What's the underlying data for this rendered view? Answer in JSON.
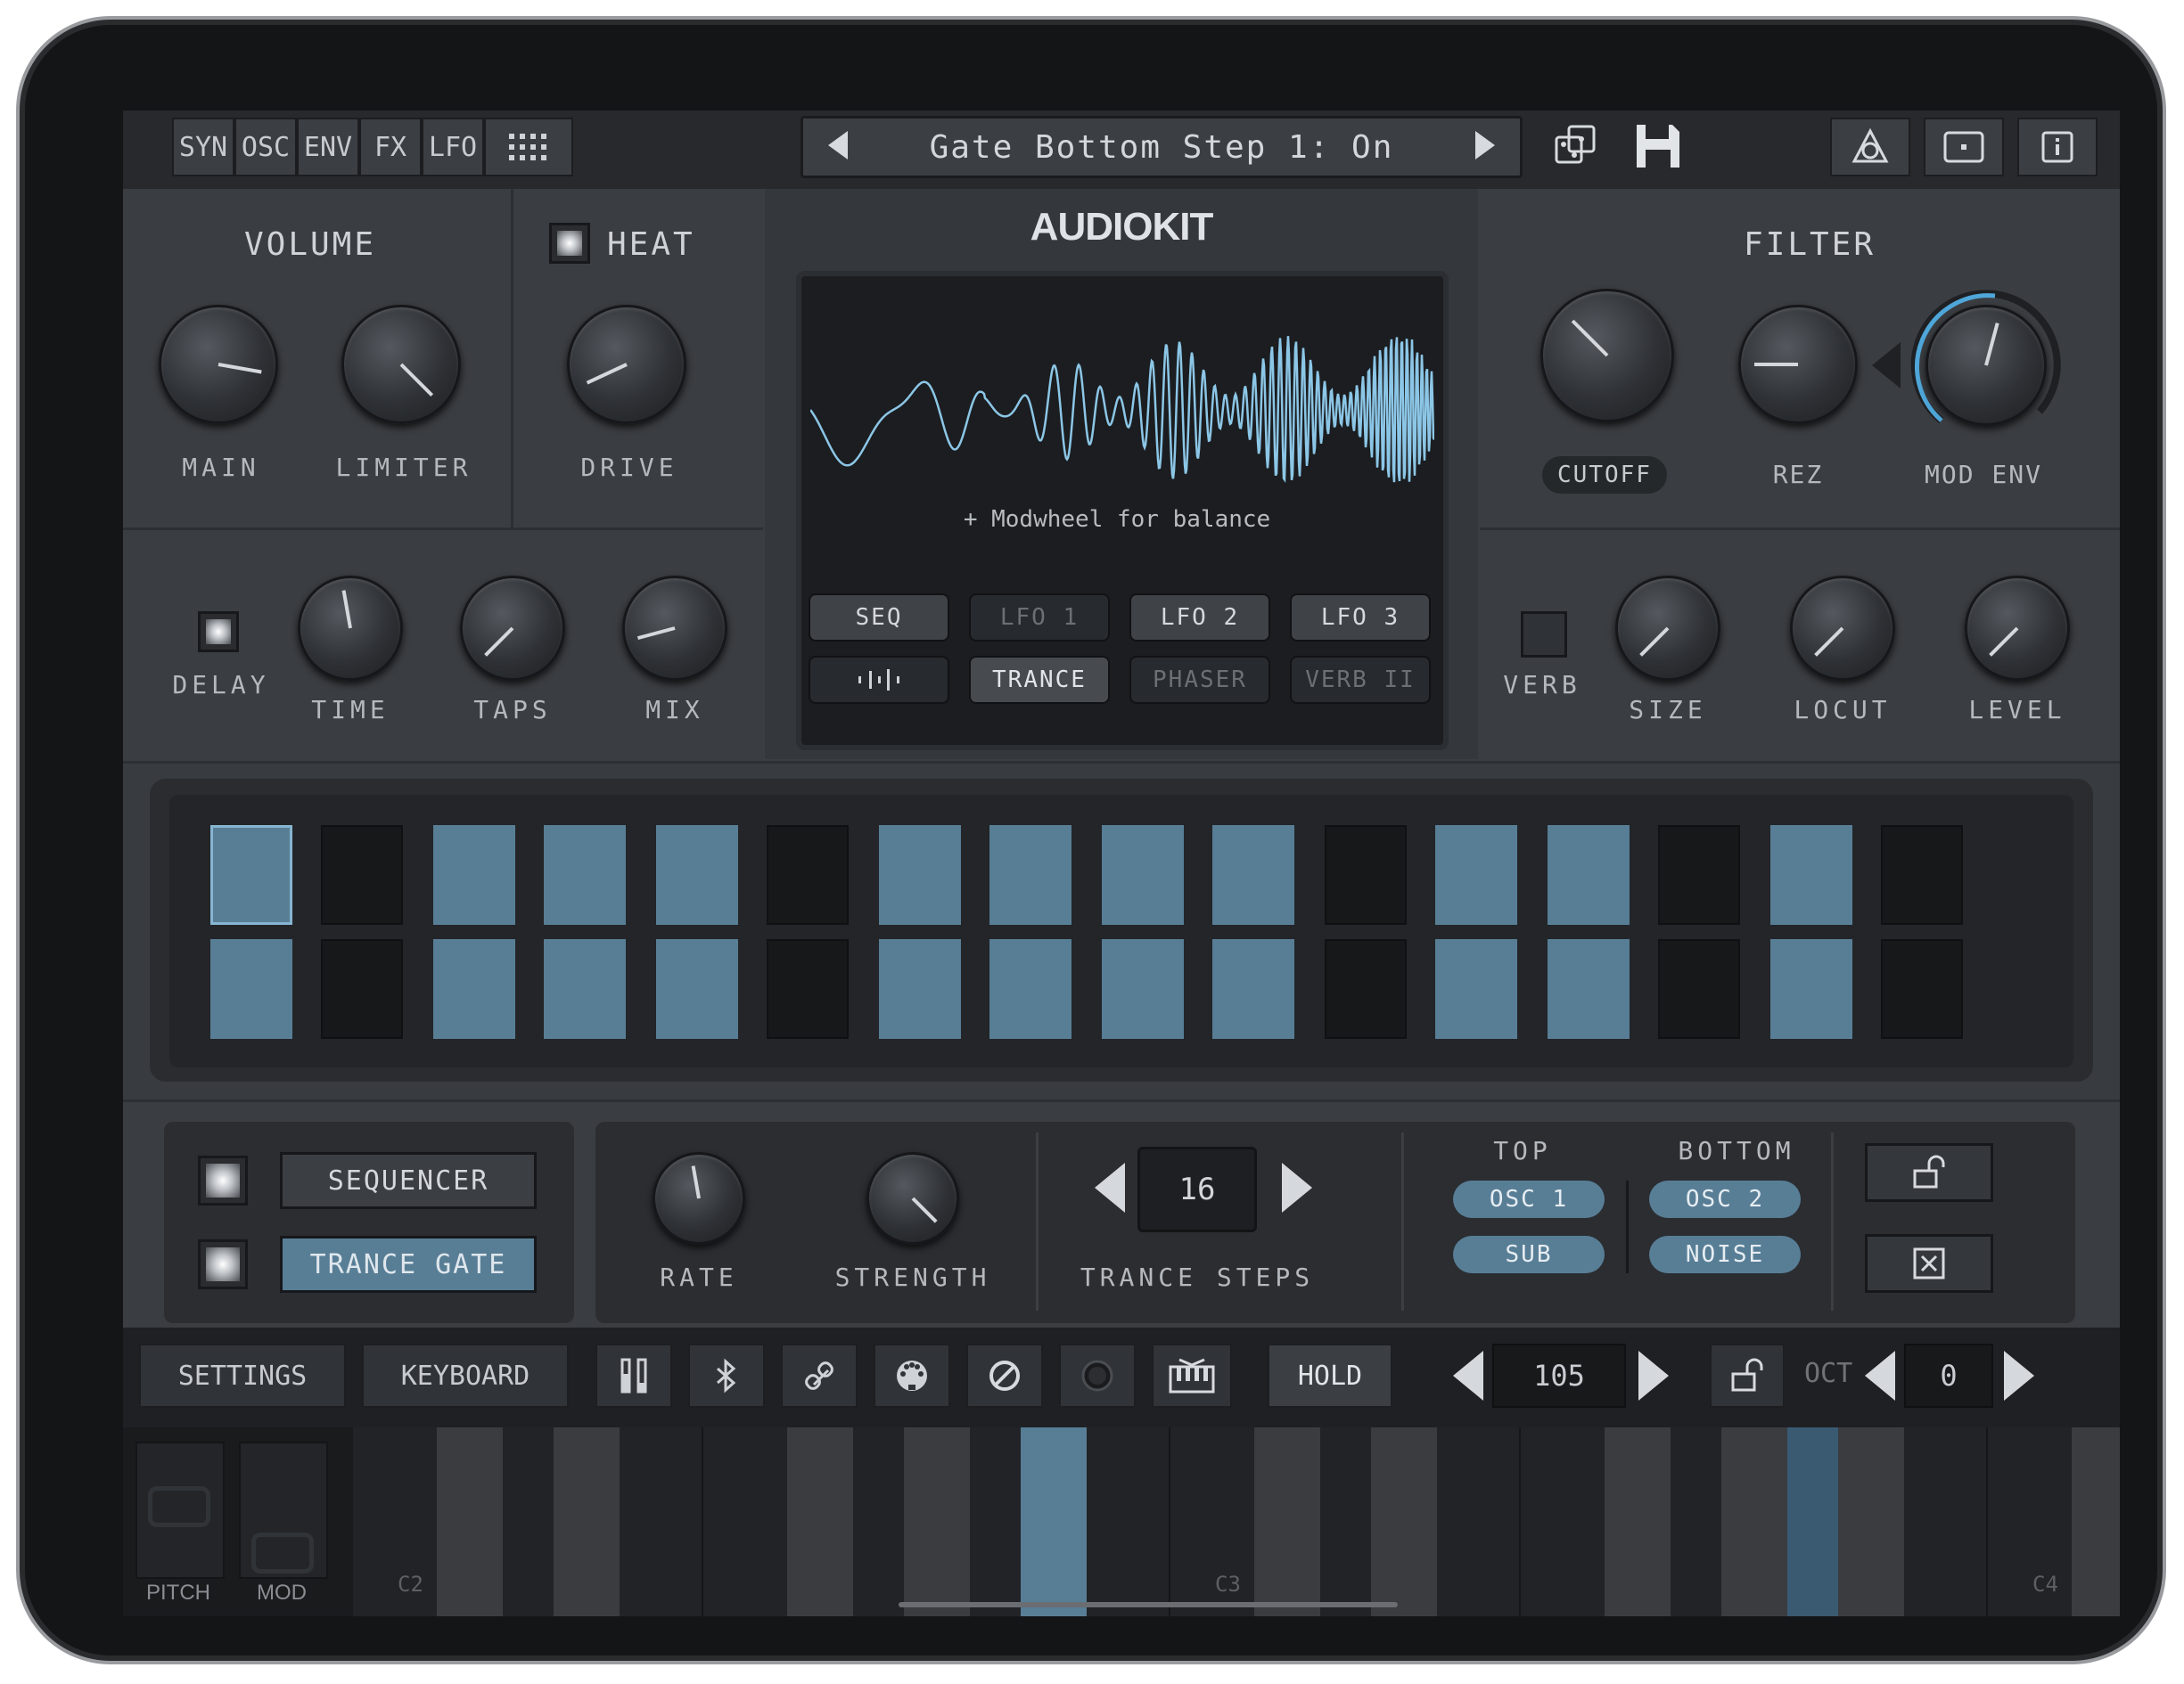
{
  "topbar": {
    "tabs": [
      "SYN",
      "OSC",
      "ENV",
      "FX",
      "LFO"
    ],
    "grid_icon": "grid-icon",
    "preset_name": "Gate Bottom Step 1: On",
    "icons": [
      "dice-icon",
      "save-icon",
      "audiobus-icon",
      "window-icon",
      "info-icon"
    ]
  },
  "volume": {
    "title": "VOLUME",
    "knobs": [
      "MAIN",
      "LIMITER"
    ]
  },
  "heat": {
    "title": "HEAT",
    "knob": "DRIVE"
  },
  "brand": "AUDIOKIT",
  "display": {
    "caption": "+ Modwheel for balance",
    "buttons_row1": [
      "SEQ",
      "LFO 1",
      "LFO 2",
      "LFO 3"
    ],
    "buttons_row2": [
      "",
      "TRANCE",
      "PHASER",
      "VERB II"
    ]
  },
  "filter": {
    "title": "FILTER",
    "knobs": [
      "CUTOFF",
      "REZ",
      "MOD ENV"
    ]
  },
  "delay": {
    "label": "DELAY",
    "knobs": [
      "TIME",
      "TAPS",
      "MIX"
    ]
  },
  "verb": {
    "label": "VERB",
    "knobs": [
      "SIZE",
      "LOCUT",
      "LEVEL"
    ]
  },
  "sequencer": {
    "row1": [
      1,
      0,
      1,
      1,
      1,
      0,
      1,
      1,
      1,
      1,
      0,
      1,
      1,
      0,
      1,
      0
    ],
    "row2": [
      1,
      0,
      1,
      1,
      1,
      0,
      1,
      1,
      1,
      1,
      0,
      1,
      1,
      0,
      1,
      0
    ]
  },
  "mode": {
    "sequencer_label": "SEQUENCER",
    "trance_gate_label": "TRANCE GATE"
  },
  "gate": {
    "rate_label": "RATE",
    "strength_label": "STRENGTH",
    "steps_value": "16",
    "steps_label": "TRANCE STEPS",
    "top_label": "TOP",
    "bottom_label": "BOTTOM",
    "top_options": [
      "OSC 1",
      "SUB"
    ],
    "bottom_options": [
      "OSC 2",
      "NOISE"
    ]
  },
  "toolbar": {
    "settings": "SETTINGS",
    "keyboard": "KEYBOARD",
    "hold": "HOLD",
    "bpm": "105",
    "oct_label": "OCT",
    "oct_value": "0"
  },
  "keyboard": {
    "pitch_label": "PITCH",
    "mod_label": "MOD",
    "note_labels": [
      "C2",
      "C3",
      "C4"
    ]
  },
  "colors": {
    "accent": "#587e96",
    "wave": "#8cc6e6",
    "bg": "#3a3d41"
  }
}
